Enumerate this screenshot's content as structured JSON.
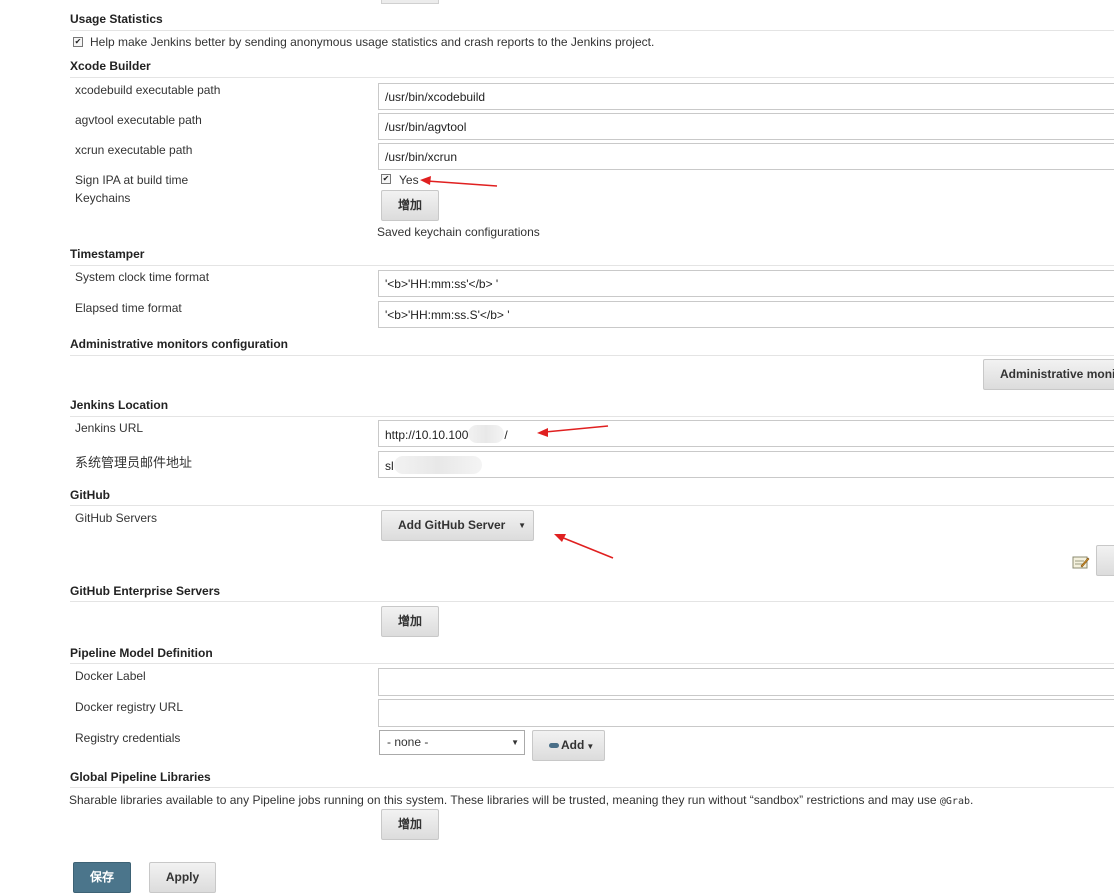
{
  "usage_statistics": {
    "title": "Usage Statistics",
    "checkbox_label": "Help make Jenkins better by sending anonymous usage statistics and crash reports to the Jenkins project.",
    "checked": true
  },
  "xcode_builder": {
    "title": "Xcode Builder",
    "xcodebuild_label": "xcodebuild executable path",
    "xcodebuild_value": "/usr/bin/xcodebuild",
    "agvtool_label": "agvtool executable path",
    "agvtool_value": "/usr/bin/agvtool",
    "xcrun_label": "xcrun executable path",
    "xcrun_value": "/usr/bin/xcrun",
    "sign_ipa_label": "Sign IPA at build time",
    "sign_ipa_option": "Yes",
    "sign_ipa_checked": true,
    "keychains_label": "Keychains",
    "add_button": "增加",
    "saved_keychain_text": "Saved keychain configurations"
  },
  "timestamper": {
    "title": "Timestamper",
    "system_clock_label": "System clock time format",
    "system_clock_value": "'<b>'HH:mm:ss'</b> '",
    "elapsed_label": "Elapsed time format",
    "elapsed_value": "'<b>'HH:mm:ss.S'</b> '"
  },
  "admin_monitors": {
    "title": "Administrative monitors configuration",
    "button_label": "Administrative moni"
  },
  "jenkins_location": {
    "title": "Jenkins Location",
    "url_label": "Jenkins URL",
    "url_value": "http://10.10.100",
    "url_suffix": "/",
    "email_label": "系统管理员邮件地址",
    "email_value": "sl"
  },
  "github": {
    "title": "GitHub",
    "servers_label": "GitHub Servers",
    "add_server_button": "Add GitHub Server"
  },
  "github_enterprise": {
    "title": "GitHub Enterprise Servers",
    "add_button": "增加"
  },
  "pipeline_model": {
    "title": "Pipeline Model Definition",
    "docker_label_label": "Docker Label",
    "docker_label_value": "",
    "docker_registry_label": "Docker registry URL",
    "docker_registry_value": "",
    "registry_credentials_label": "Registry credentials",
    "credentials_selected": "- none -",
    "add_button": "Add"
  },
  "global_libraries": {
    "title": "Global Pipeline Libraries",
    "description_prefix": "Sharable libraries available to any Pipeline jobs running on this system. These libraries will be trusted, meaning they run without “sandbox” restrictions and may use ",
    "description_code": "@Grab",
    "description_suffix": ".",
    "add_button": "增加"
  },
  "footer": {
    "save_button": "保存",
    "apply_button": "Apply"
  },
  "colors": {
    "primary_button": "#4b758b",
    "annotation_arrow": "#e02020"
  }
}
